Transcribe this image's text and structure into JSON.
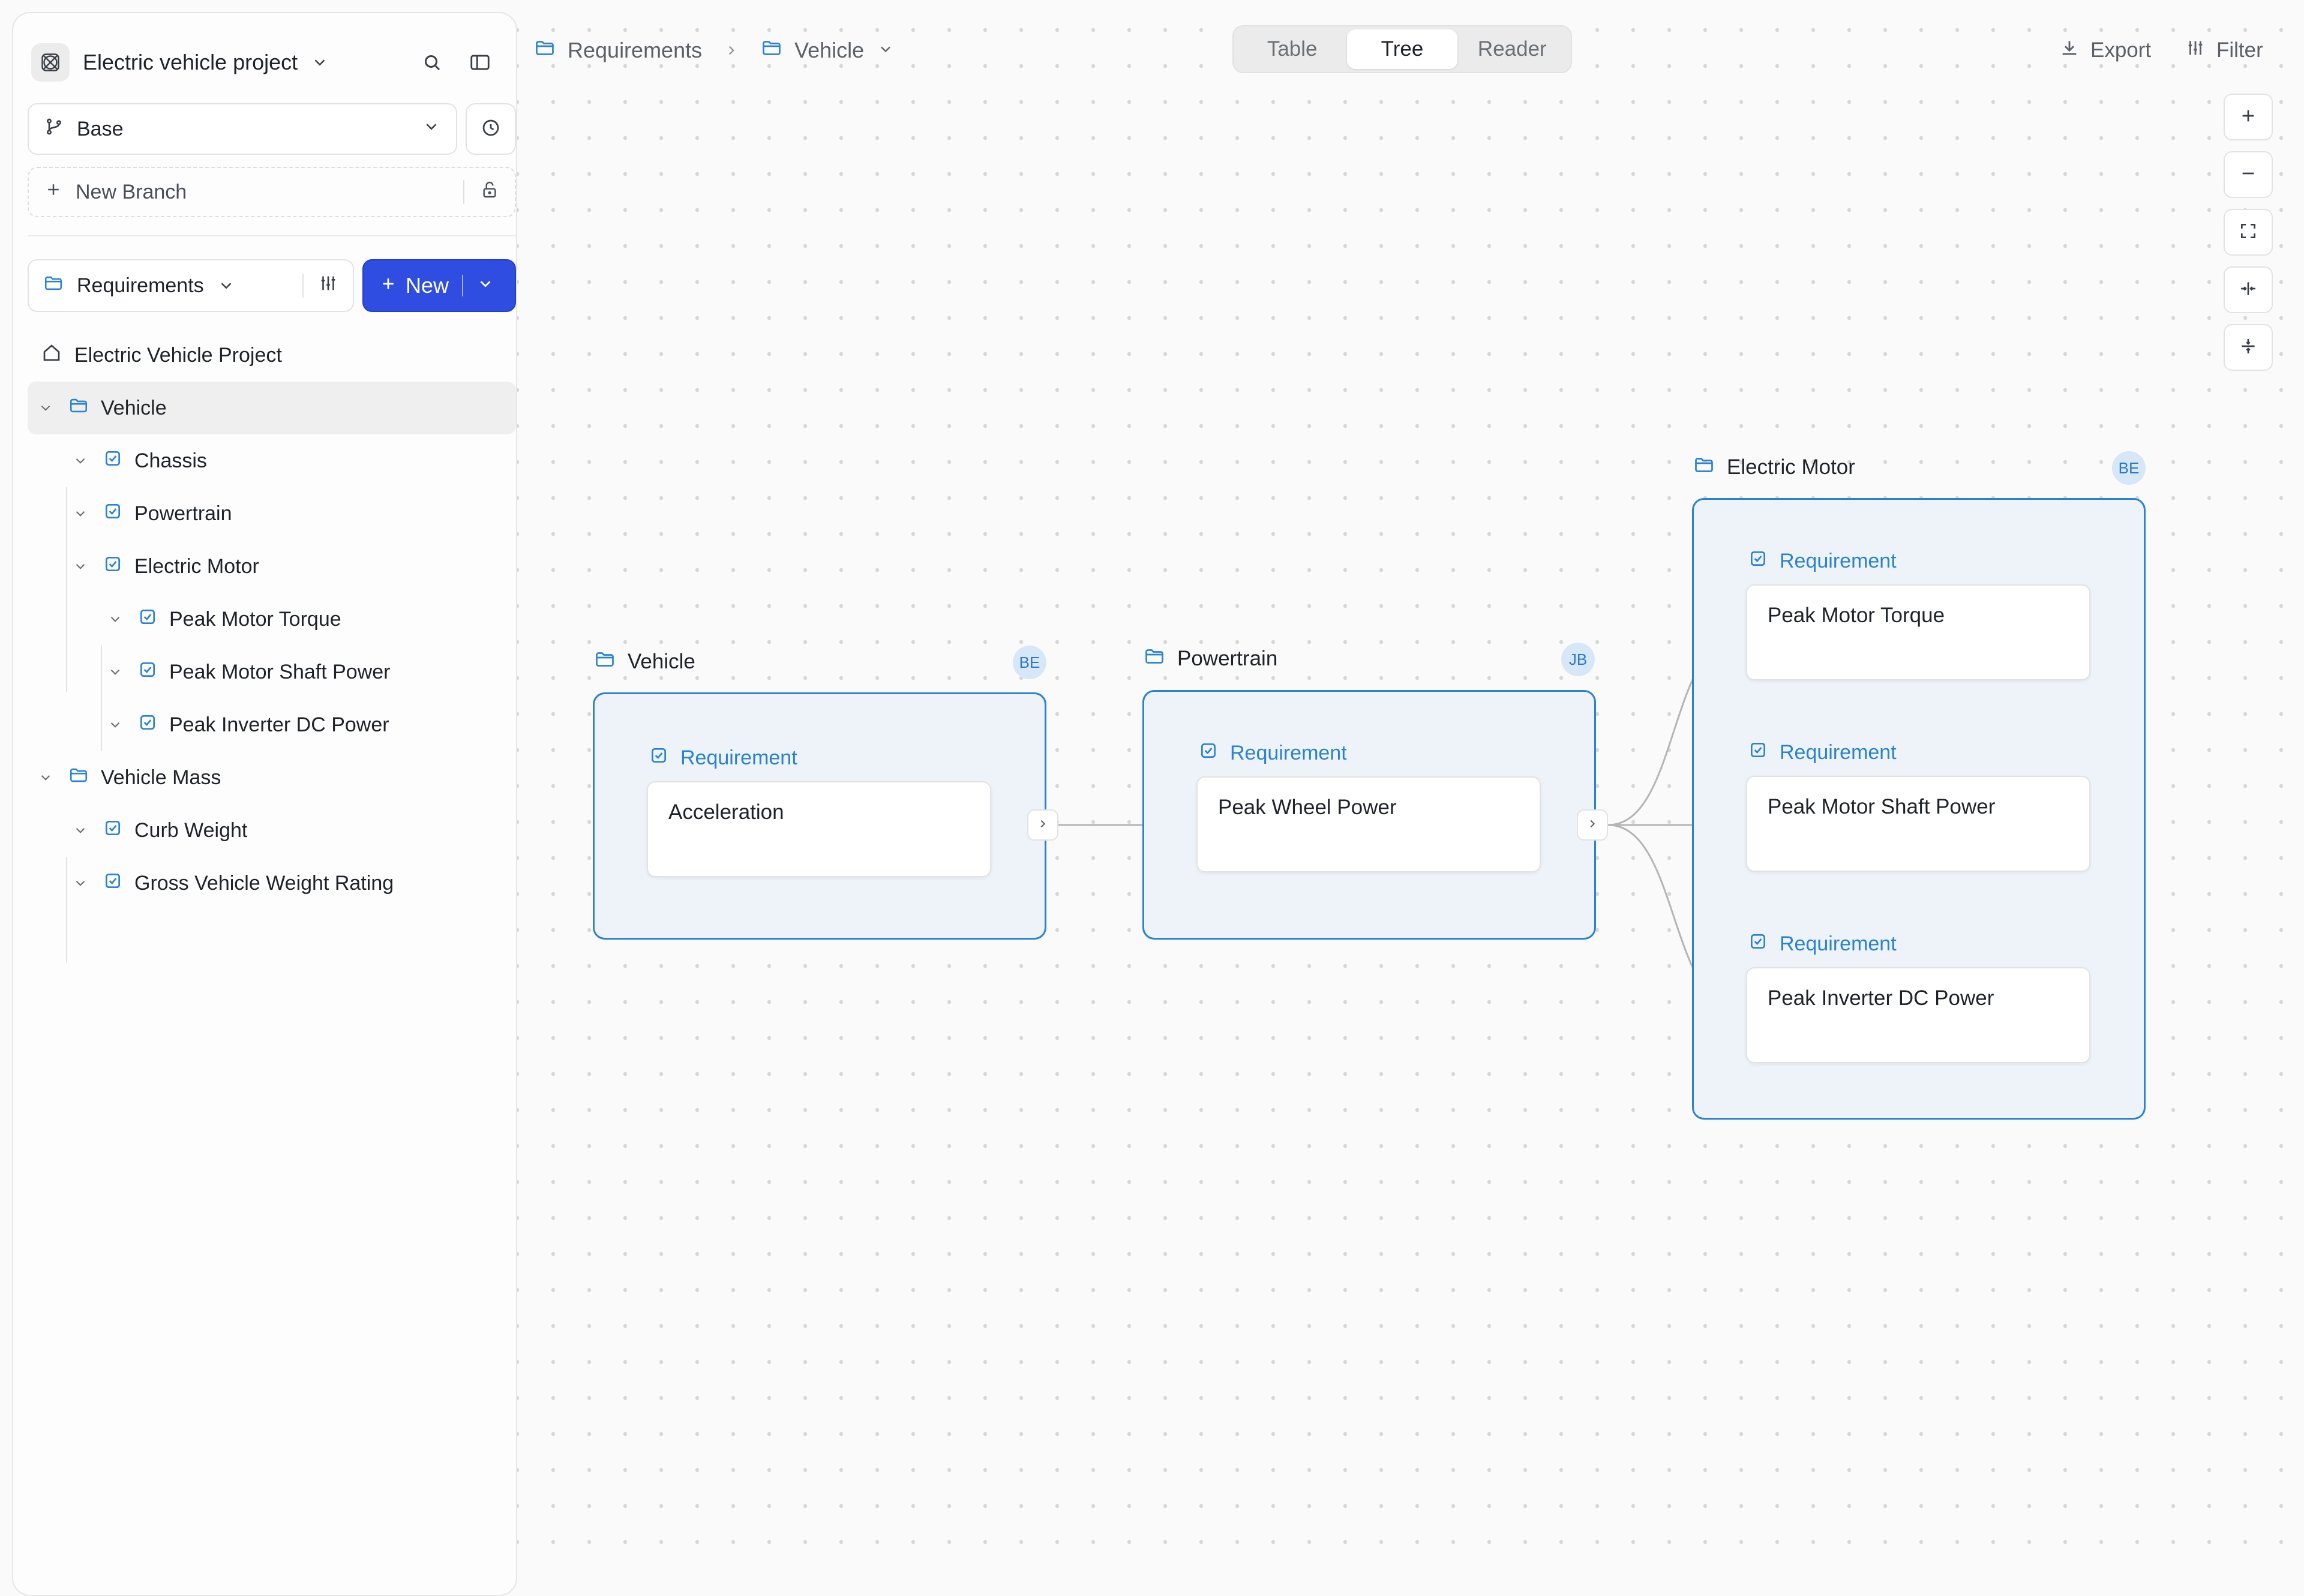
{
  "colors": {
    "accent_blue": "#2b82cf",
    "primary_button": "#2f4de0",
    "group_fill": "#eef3f9",
    "avatar_bg": "#d6e7f7"
  },
  "sidebar": {
    "project_title": "Electric vehicle project",
    "branch": "Base",
    "new_branch_label": "New Branch",
    "section_select": "Requirements",
    "new_button": "New",
    "tree": [
      {
        "label": "Electric Vehicle Project",
        "icon": "home-icon",
        "level": 0
      },
      {
        "label": "Vehicle",
        "icon": "folder-icon",
        "level": 0,
        "selected": true
      },
      {
        "label": "Chassis",
        "icon": "checkbox-icon",
        "level": 1
      },
      {
        "label": "Powertrain",
        "icon": "checkbox-icon",
        "level": 1
      },
      {
        "label": "Electric Motor",
        "icon": "checkbox-icon",
        "level": 1
      },
      {
        "label": "Peak Motor Torque",
        "icon": "checkbox-icon",
        "level": 2
      },
      {
        "label": "Peak Motor Shaft Power",
        "icon": "checkbox-icon",
        "level": 2
      },
      {
        "label": "Peak Inverter DC Power",
        "icon": "checkbox-icon",
        "level": 2
      },
      {
        "label": "Vehicle Mass",
        "icon": "folder-icon",
        "level": 0
      },
      {
        "label": "Curb Weight",
        "icon": "checkbox-icon",
        "level": 1
      },
      {
        "label": "Gross Vehicle Weight Rating",
        "icon": "checkbox-icon",
        "level": 1
      }
    ]
  },
  "breadcrumb": {
    "root": "Requirements",
    "current": "Vehicle"
  },
  "view_toggle": {
    "options": [
      "Table",
      "Tree",
      "Reader"
    ],
    "active": "Tree"
  },
  "toolbar": {
    "export_label": "Export",
    "filter_label": "Filter"
  },
  "canvas": {
    "groups": [
      {
        "title": "Vehicle",
        "avatar": "BE",
        "requirements": [
          {
            "tag": "Requirement",
            "title": "Acceleration"
          }
        ]
      },
      {
        "title": "Powertrain",
        "avatar": "JB",
        "requirements": [
          {
            "tag": "Requirement",
            "title": "Peak Wheel Power"
          }
        ]
      },
      {
        "title": "Electric Motor",
        "avatar": "BE",
        "requirements": [
          {
            "tag": "Requirement",
            "title": "Peak Motor Torque"
          },
          {
            "tag": "Requirement",
            "title": "Peak Motor Shaft Power"
          },
          {
            "tag": "Requirement",
            "title": "Peak Inverter DC Power"
          }
        ]
      }
    ]
  }
}
